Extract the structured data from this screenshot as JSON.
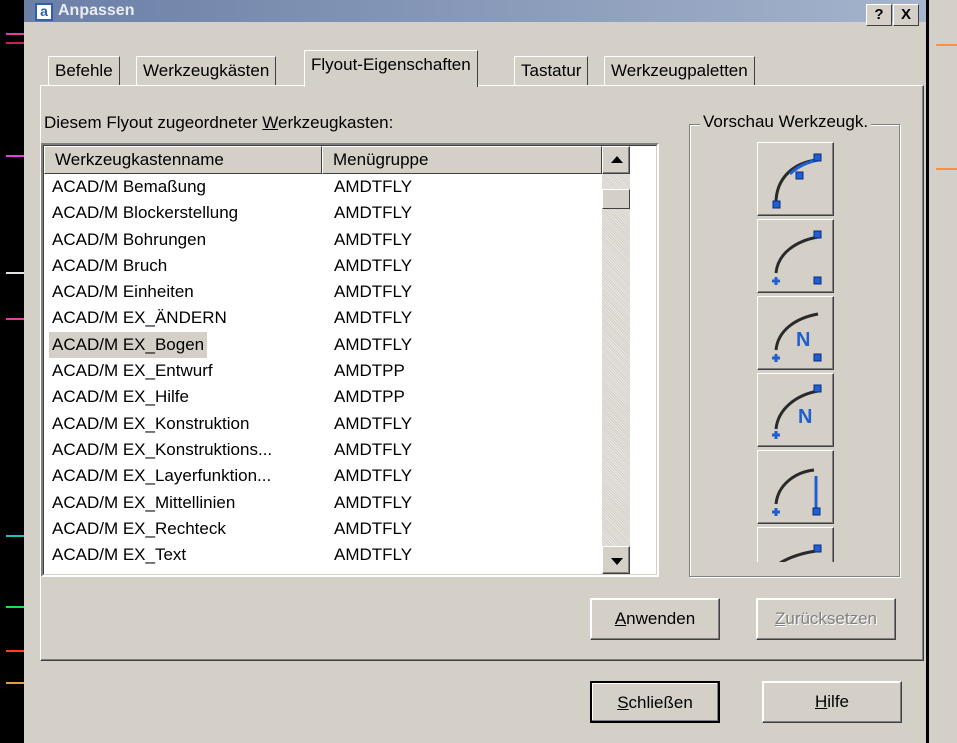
{
  "window": {
    "title": "Anpassen",
    "icon_glyph": "a",
    "help_glyph": "?",
    "close_glyph": "X"
  },
  "tabs": [
    {
      "label": "Befehle"
    },
    {
      "label": "Werkzeugkästen"
    },
    {
      "label": "Flyout-Eigenschaften",
      "active": true
    },
    {
      "label": "Tastatur"
    },
    {
      "label": "Werkzeugpaletten"
    }
  ],
  "list": {
    "label_before": "Diesem Flyout zugeordneter ",
    "label_mnemonic": "W",
    "label_after": "erkzeugkasten:",
    "columns": [
      "Werkzeugkastenname",
      "Menügruppe"
    ],
    "rows": [
      {
        "name": "ACAD/M Bemaßung",
        "group": "AMDTFLY"
      },
      {
        "name": "ACAD/M Blockerstellung",
        "group": "AMDTFLY"
      },
      {
        "name": "ACAD/M Bohrungen",
        "group": "AMDTFLY"
      },
      {
        "name": "ACAD/M Bruch",
        "group": "AMDTFLY"
      },
      {
        "name": "ACAD/M Einheiten",
        "group": "AMDTFLY"
      },
      {
        "name": "ACAD/M EX_ÄNDERN",
        "group": "AMDTFLY"
      },
      {
        "name": "ACAD/M EX_Bogen",
        "group": "AMDTFLY",
        "selected": true
      },
      {
        "name": "ACAD/M EX_Entwurf",
        "group": "AMDTPP"
      },
      {
        "name": "ACAD/M EX_Hilfe",
        "group": "AMDTPP"
      },
      {
        "name": "ACAD/M EX_Konstruktion",
        "group": "AMDTFLY"
      },
      {
        "name": "ACAD/M EX_Konstruktions...",
        "group": "AMDTFLY"
      },
      {
        "name": "ACAD/M EX_Layerfunktion...",
        "group": "AMDTFLY"
      },
      {
        "name": "ACAD/M EX_Mittellinien",
        "group": "AMDTFLY"
      },
      {
        "name": "ACAD/M EX_Rechteck",
        "group": "AMDTFLY"
      },
      {
        "name": "ACAD/M EX_Text",
        "group": "AMDTFLY"
      }
    ]
  },
  "preview": {
    "title": "Vorschau Werkzeugk.",
    "tools": [
      "arc-3point-icon",
      "arc-start-center-end-icon",
      "arc-n-icon",
      "arc-n-icon-2",
      "arc-line-icon",
      "arc-partial-icon"
    ]
  },
  "buttons": {
    "apply": {
      "mnemonic": "A",
      "rest": "nwenden"
    },
    "reset": {
      "mnemonic": "Z",
      "rest": "urücksetzen",
      "disabled": true
    },
    "close": {
      "mnemonic": "S",
      "rest": "chließen"
    },
    "help": {
      "mnemonic": "H",
      "rest": "ilfe"
    }
  },
  "colors": {
    "face": "#d4d0c8",
    "title_gradient_start": "#6b7fa6",
    "title_gradient_end": "#a5b4cc",
    "icon_blue": "#1f5fd0",
    "icon_stroke": "#2a2a2a"
  }
}
